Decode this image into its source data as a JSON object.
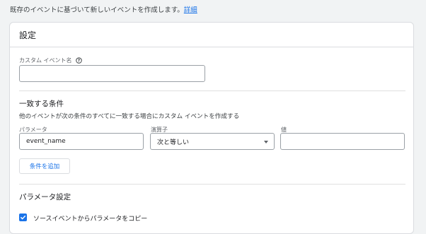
{
  "intro": {
    "text": "既存のイベントに基づいて新しいイベントを作成します。",
    "link": "詳細"
  },
  "card": {
    "title": "設定"
  },
  "custom_event": {
    "label": "カスタム イベント名",
    "help_icon": "help-circle-icon",
    "value": ""
  },
  "conditions": {
    "title": "一致する条件",
    "description": "他のイベントが次の条件のすべてに一致する場合にカスタム イベントを作成する",
    "param_label": "パラメータ",
    "param_value": "event_name",
    "operator_label": "演算子",
    "operator_value": "次と等しい",
    "value_label": "値",
    "value_value": "",
    "add_button": "条件を追加"
  },
  "param_settings": {
    "title": "パラメータ設定",
    "copy_checkbox_label": "ソースイベントからパラメータをコピー",
    "copy_checked": true
  },
  "colors": {
    "accent": "#1a73e8",
    "background": "#f1f3f4",
    "border": "#dadce0"
  }
}
